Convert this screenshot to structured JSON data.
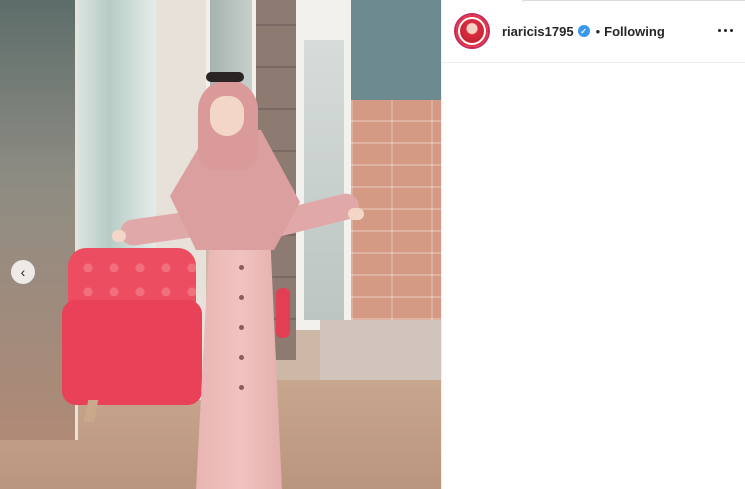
{
  "post": {
    "author": {
      "username": "riaricis1795",
      "verified": true
    },
    "separator": "•",
    "follow_label": "Following",
    "media": {
      "carousel_prev_glyph": "‹"
    }
  },
  "icons": {
    "verified": "verified-badge-icon",
    "more": "more-options-icon",
    "carousel_prev": "chevron-left-icon"
  },
  "colors": {
    "verified_blue": "#3897f0",
    "text": "#262626",
    "avatar_ring": "#c6285b"
  }
}
